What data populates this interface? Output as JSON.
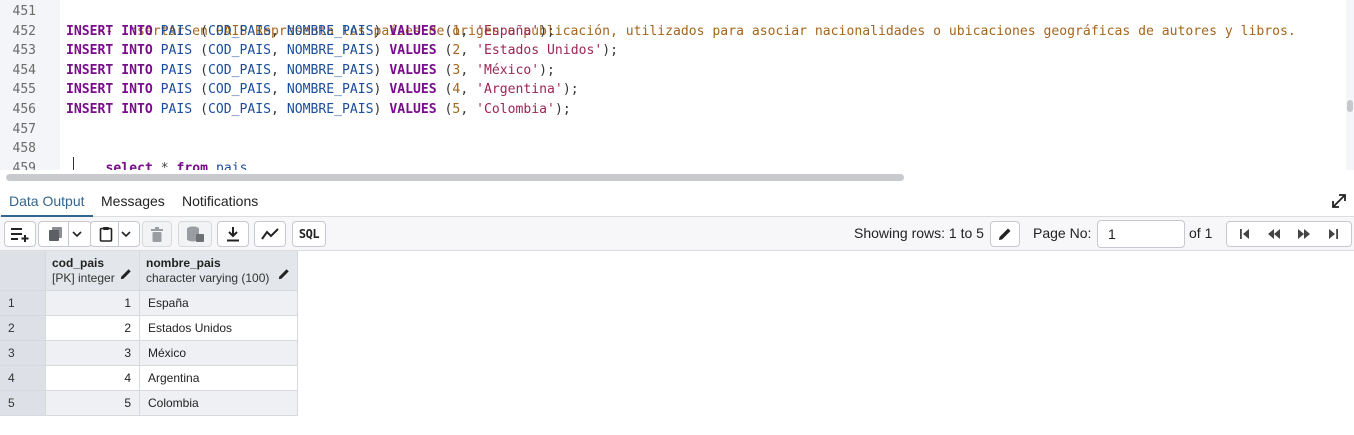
{
  "editor": {
    "line_numbers": [
      "451",
      "452",
      "453",
      "454",
      "455",
      "456",
      "457",
      "458",
      "459"
    ],
    "comment": "-- Insertar en PAIS Representa los países de origen o publicación, utilizados para asociar nacionalidades o ubicaciones geográficas de autores y libros.",
    "kw_insert": "INSERT",
    "kw_into": "INTO",
    "table": "PAIS",
    "col_cod": "COD_PAIS",
    "col_nombre": "NOMBRE_PAIS",
    "kw_values": "VALUES",
    "inserts": [
      {
        "num": "1",
        "str": "'España'"
      },
      {
        "num": "2",
        "str": "'Estados Unidos'"
      },
      {
        "num": "3",
        "str": "'México'"
      },
      {
        "num": "4",
        "str": "'Argentina'"
      },
      {
        "num": "5",
        "str": "'Colombia'"
      }
    ],
    "select_kw": "select",
    "select_star": "*",
    "from_kw": "from",
    "select_table": "pais"
  },
  "tabs": {
    "data_output": "Data Output",
    "messages": "Messages",
    "notifications": "Notifications",
    "active": "data_output"
  },
  "toolbar": {
    "sql_label": "SQL",
    "showing_rows": "Showing rows: 1 to 5",
    "page_label": "Page No:",
    "page_value": "1",
    "of_label": "of 1"
  },
  "grid": {
    "columns": [
      {
        "name": "cod_pais",
        "type": "[PK] integer"
      },
      {
        "name": "nombre_pais",
        "type": "character varying (100)"
      }
    ],
    "rows": [
      {
        "n": "1",
        "cod_pais": "1",
        "nombre_pais": "España"
      },
      {
        "n": "2",
        "cod_pais": "2",
        "nombre_pais": "Estados Unidos"
      },
      {
        "n": "3",
        "cod_pais": "3",
        "nombre_pais": "México"
      },
      {
        "n": "4",
        "cod_pais": "4",
        "nombre_pais": "Argentina"
      },
      {
        "n": "5",
        "cod_pais": "5",
        "nombre_pais": "Colombia"
      }
    ]
  },
  "colors": {
    "accent": "#326690",
    "keyword": "#7a0b8c",
    "identifier": "#1b4d9c",
    "string": "#9c2555",
    "comment": "#a5651c"
  }
}
